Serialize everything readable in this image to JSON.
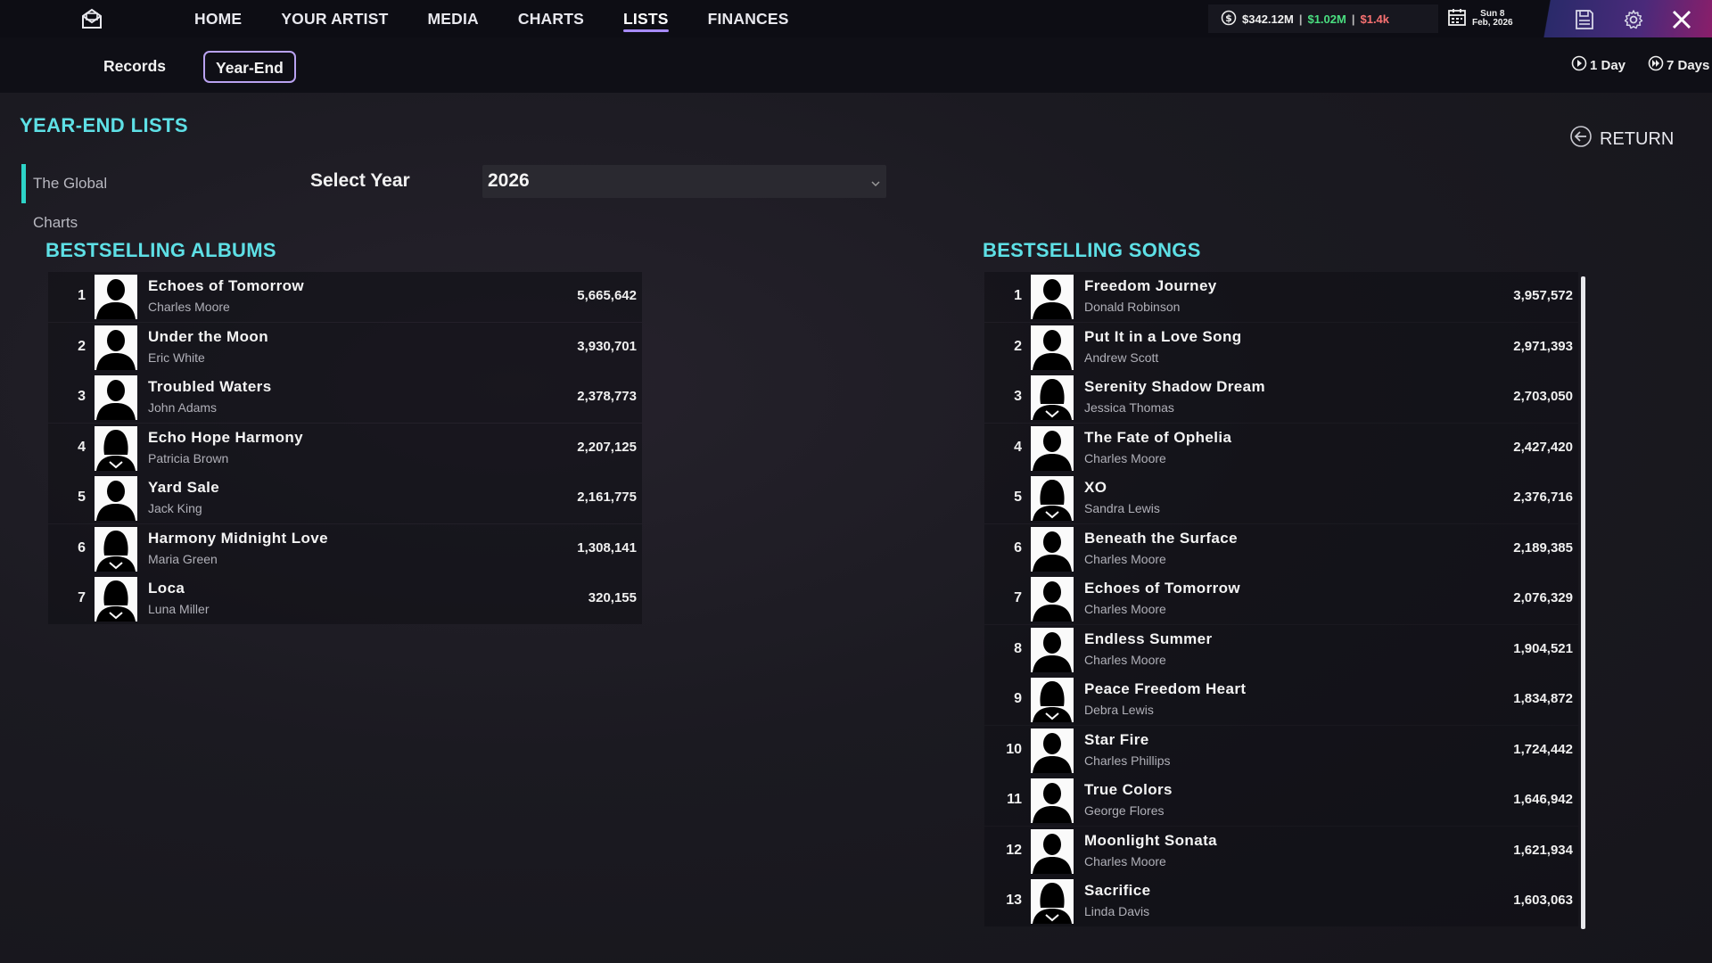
{
  "nav": {
    "items": [
      {
        "label": "HOME",
        "active": false
      },
      {
        "label": "YOUR ARTIST",
        "active": false
      },
      {
        "label": "MEDIA",
        "active": false
      },
      {
        "label": "CHARTS",
        "active": false
      },
      {
        "label": "LISTS",
        "active": true
      },
      {
        "label": "FINANCES",
        "active": false
      }
    ]
  },
  "stats": {
    "balance": "$342.12M",
    "income": "$1.02M",
    "expense": "$1.4k",
    "date_line1": "Sun 8",
    "date_line2": "Feb, 2026"
  },
  "colors": {
    "accent_cyan": "#5ee0e6",
    "income_green": "#4ade80",
    "expense_red": "#f87171",
    "active_purple": "#a78bfa"
  },
  "subnav": {
    "tabs": [
      {
        "label": "Records",
        "active": false
      },
      {
        "label": "Year-End",
        "active": true
      }
    ],
    "speed_1": "1 Day",
    "speed_7": "7 Days"
  },
  "page": {
    "title": "YEAR-END LISTS",
    "return_label": "RETURN",
    "source_tab": "The Global Charts",
    "year_label": "Select Year",
    "year_value": "2026"
  },
  "albums": {
    "title": "BESTSELLING ALBUMS",
    "rows": [
      {
        "rank": "1",
        "title": "Echoes of Tomorrow",
        "artist": "Charles Moore",
        "units": "5,665,642",
        "gender": "m"
      },
      {
        "rank": "2",
        "title": "Under the Moon",
        "artist": "Eric White",
        "units": "3,930,701",
        "gender": "m"
      },
      {
        "rank": "3",
        "title": "Troubled Waters",
        "artist": "John Adams",
        "units": "2,378,773",
        "gender": "m"
      },
      {
        "rank": "4",
        "title": "Echo Hope Harmony",
        "artist": "Patricia Brown",
        "units": "2,207,125",
        "gender": "f"
      },
      {
        "rank": "5",
        "title": "Yard Sale",
        "artist": "Jack King",
        "units": "2,161,775",
        "gender": "m"
      },
      {
        "rank": "6",
        "title": "Harmony Midnight Love",
        "artist": "Maria Green",
        "units": "1,308,141",
        "gender": "f"
      },
      {
        "rank": "7",
        "title": "Loca",
        "artist": "Luna Miller",
        "units": "320,155",
        "gender": "f"
      }
    ]
  },
  "songs": {
    "title": "BESTSELLING SONGS",
    "rows": [
      {
        "rank": "1",
        "title": "Freedom Journey",
        "artist": "Donald Robinson",
        "units": "3,957,572",
        "gender": "m"
      },
      {
        "rank": "2",
        "title": "Put It in a Love Song",
        "artist": "Andrew Scott",
        "units": "2,971,393",
        "gender": "m"
      },
      {
        "rank": "3",
        "title": "Serenity Shadow Dream",
        "artist": "Jessica Thomas",
        "units": "2,703,050",
        "gender": "f"
      },
      {
        "rank": "4",
        "title": "The Fate of Ophelia",
        "artist": "Charles Moore",
        "units": "2,427,420",
        "gender": "m"
      },
      {
        "rank": "5",
        "title": "XO",
        "artist": "Sandra Lewis",
        "units": "2,376,716",
        "gender": "f"
      },
      {
        "rank": "6",
        "title": "Beneath the Surface",
        "artist": "Charles Moore",
        "units": "2,189,385",
        "gender": "m"
      },
      {
        "rank": "7",
        "title": "Echoes of Tomorrow",
        "artist": "Charles Moore",
        "units": "2,076,329",
        "gender": "m"
      },
      {
        "rank": "8",
        "title": "Endless Summer",
        "artist": "Charles Moore",
        "units": "1,904,521",
        "gender": "m"
      },
      {
        "rank": "9",
        "title": "Peace Freedom Heart",
        "artist": "Debra Lewis",
        "units": "1,834,872",
        "gender": "f"
      },
      {
        "rank": "10",
        "title": "Star Fire",
        "artist": "Charles Phillips",
        "units": "1,724,442",
        "gender": "m"
      },
      {
        "rank": "11",
        "title": "True Colors",
        "artist": "George Flores",
        "units": "1,646,942",
        "gender": "m"
      },
      {
        "rank": "12",
        "title": "Moonlight Sonata",
        "artist": "Charles Moore",
        "units": "1,621,934",
        "gender": "m"
      },
      {
        "rank": "13",
        "title": "Sacrifice",
        "artist": "Linda Davis",
        "units": "1,603,063",
        "gender": "f"
      }
    ]
  }
}
